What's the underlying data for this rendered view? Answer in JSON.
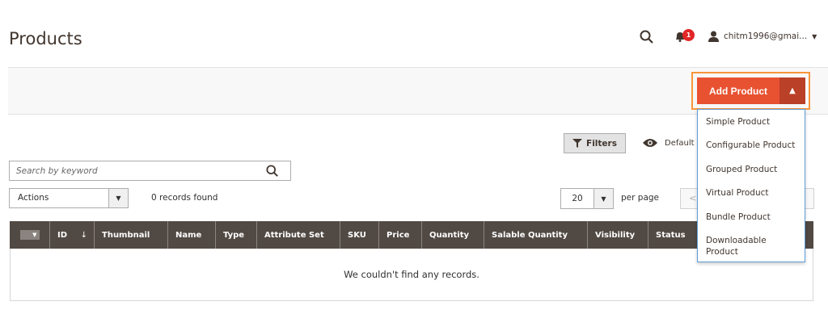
{
  "header": {
    "title": "Products",
    "notifications": "1",
    "user": "chitm1996@gmai..."
  },
  "add_product": {
    "label": "Add Product",
    "menu": [
      "Simple Product",
      "Configurable Product",
      "Grouped Product",
      "Virtual Product",
      "Bundle Product",
      "Downloadable Product"
    ]
  },
  "toolbar": {
    "filters": "Filters",
    "default_view": "Default V",
    "search_placeholder": "Search by keyword",
    "actions": "Actions",
    "records_found": "0 records found",
    "per_page_value": "20",
    "per_page_label": "per page",
    "pager_prev": "<"
  },
  "table": {
    "columns": [
      "ID",
      "Thumbnail",
      "Name",
      "Type",
      "Attribute Set",
      "SKU",
      "Price",
      "Quantity",
      "Salable Quantity",
      "Visibility",
      "Status"
    ],
    "empty": "We couldn't find any records.",
    "sort_indicator": "↓"
  }
}
